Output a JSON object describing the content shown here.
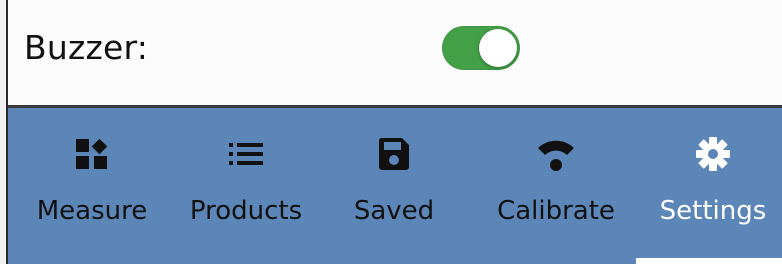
{
  "colors": {
    "nav_background": "#5b86b7",
    "toggle_on": "#43a047",
    "active_item": "#ffffff",
    "inactive_item": "#111111"
  },
  "settings": {
    "buzzer": {
      "label": "Buzzer:",
      "enabled": true
    }
  },
  "nav": {
    "active": "Settings",
    "items": [
      {
        "label": "Measure",
        "icon": "dashboard-grid-icon"
      },
      {
        "label": "Products",
        "icon": "list-icon"
      },
      {
        "label": "Saved",
        "icon": "floppy-disk-icon"
      },
      {
        "label": "Calibrate",
        "icon": "wifi-signal-icon"
      },
      {
        "label": "Settings",
        "icon": "gear-icon"
      }
    ]
  }
}
